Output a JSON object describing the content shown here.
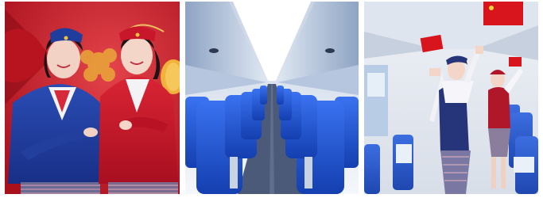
{
  "photos": [
    {
      "id": "crew-portrait",
      "colors": {
        "background": "#c41a24",
        "uniform_blue": "#1f3d9c",
        "uniform_red": "#c8162a",
        "lantern": "#f2b13a"
      }
    },
    {
      "id": "cabin-aisle",
      "colors": {
        "ceiling": "#e9eef6",
        "seat": "#1c54d6",
        "aisle": "#4a5a78"
      }
    },
    {
      "id": "cabin-decoration",
      "colors": {
        "flag": "#d8141c",
        "uniform_blue": "#26347a",
        "uniform_red": "#b0182a",
        "cabin_wall": "#e6eaf0"
      }
    }
  ]
}
